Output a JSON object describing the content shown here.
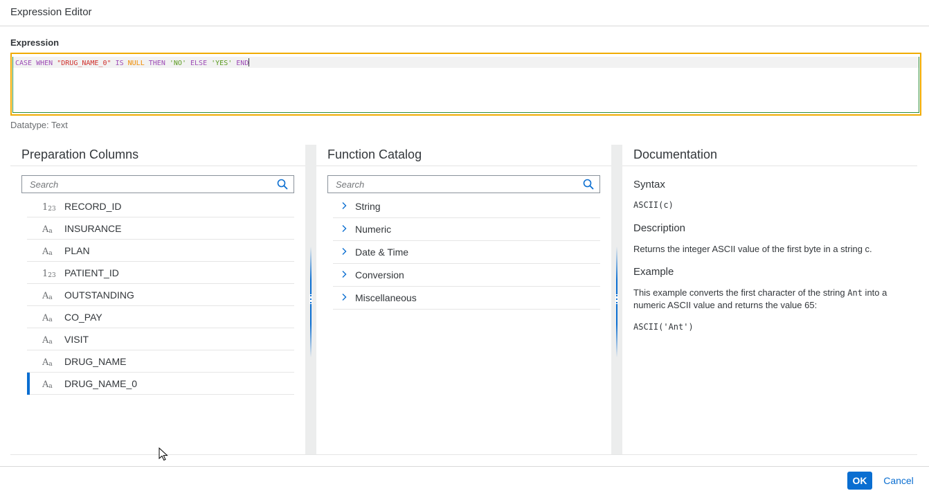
{
  "dialog": {
    "title": "Expression Editor"
  },
  "expression": {
    "label": "Expression",
    "tokens": {
      "case": "CASE",
      "when": "WHEN",
      "column": "\"DRUG_NAME_0\"",
      "is": "IS",
      "null": "NULL",
      "then": "THEN",
      "no": "'NO'",
      "else": "ELSE",
      "yes": "'YES'",
      "end": "END"
    },
    "datatype": "Datatype: Text"
  },
  "preparation_columns": {
    "title": "Preparation Columns",
    "search_placeholder": "Search",
    "items": [
      {
        "type_icon": "numeric-type-icon",
        "type_glyph": "1",
        "type_sub": "23",
        "name": "RECORD_ID"
      },
      {
        "type_icon": "text-type-icon",
        "type_glyph": "A",
        "type_sub": "a",
        "name": "INSURANCE"
      },
      {
        "type_icon": "text-type-icon",
        "type_glyph": "A",
        "type_sub": "a",
        "name": "PLAN"
      },
      {
        "type_icon": "numeric-type-icon",
        "type_glyph": "1",
        "type_sub": "23",
        "name": "PATIENT_ID"
      },
      {
        "type_icon": "text-type-icon",
        "type_glyph": "A",
        "type_sub": "a",
        "name": "OUTSTANDING"
      },
      {
        "type_icon": "text-type-icon",
        "type_glyph": "A",
        "type_sub": "a",
        "name": "CO_PAY"
      },
      {
        "type_icon": "text-type-icon",
        "type_glyph": "A",
        "type_sub": "a",
        "name": "VISIT"
      },
      {
        "type_icon": "text-type-icon",
        "type_glyph": "A",
        "type_sub": "a",
        "name": "DRUG_NAME"
      },
      {
        "type_icon": "text-type-icon",
        "type_glyph": "A",
        "type_sub": "a",
        "name": "DRUG_NAME_0",
        "selected": true
      }
    ]
  },
  "function_catalog": {
    "title": "Function Catalog",
    "search_placeholder": "Search",
    "items": [
      {
        "name": "String"
      },
      {
        "name": "Numeric"
      },
      {
        "name": "Date & Time"
      },
      {
        "name": "Conversion"
      },
      {
        "name": "Miscellaneous"
      }
    ]
  },
  "documentation": {
    "title": "Documentation",
    "syntax_heading": "Syntax",
    "syntax": "ASCII(c)",
    "description_heading": "Description",
    "description": "Returns the integer ASCII value of the first byte in a string c.",
    "example_heading": "Example",
    "example_text_1": "This example converts the first character of the string ",
    "example_text_code": "Ant",
    "example_text_2": " into a numeric ASCII value and returns the value 65:",
    "example_code": "ASCII('Ant')"
  },
  "footer": {
    "ok_label": "OK",
    "cancel_label": "Cancel"
  },
  "colors": {
    "accent": "#0a6ed1",
    "highlight_border": "#f0ab00",
    "keyword": "#9d4bb6",
    "string": "#d0312d",
    "null_literal": "#ef8b00",
    "text_literal": "#5a9a1e"
  },
  "icons": {
    "search": "search-icon",
    "expand": "chevron-right-icon",
    "splitter": "splitter-grip-icon",
    "cursor": "mouse-pointer-icon"
  }
}
